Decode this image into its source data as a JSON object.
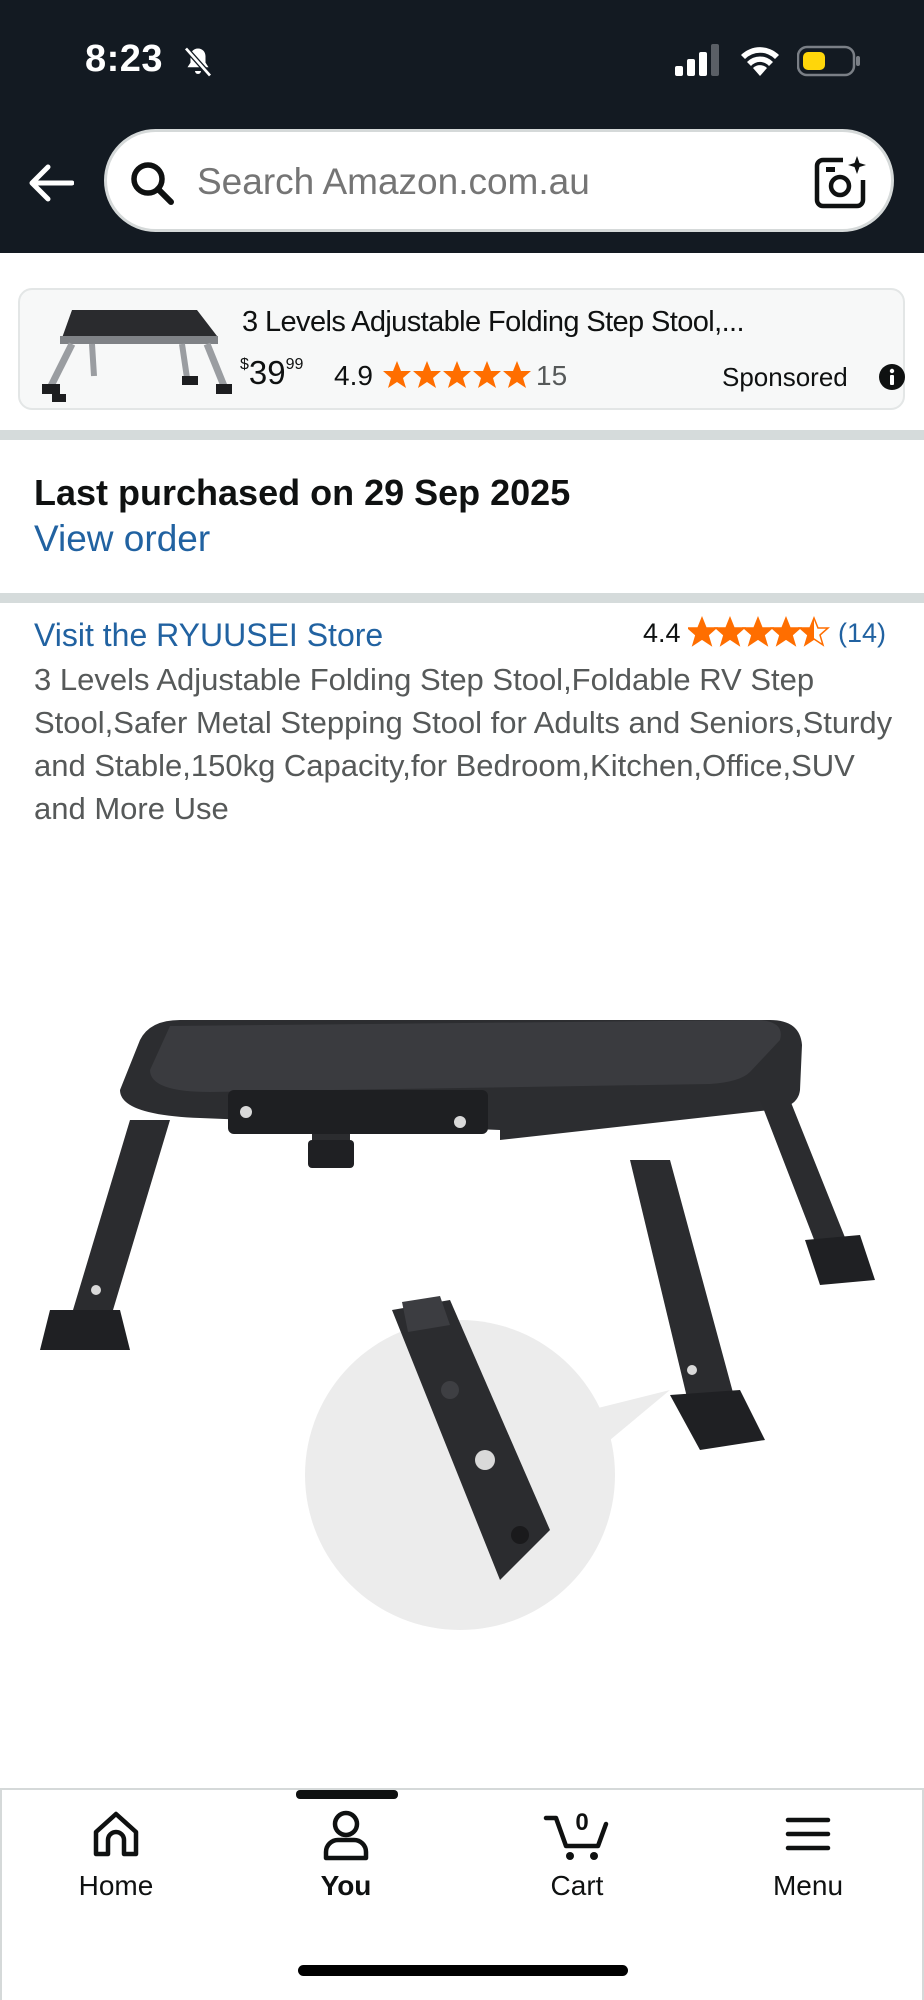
{
  "status_bar": {
    "time": "8:23"
  },
  "header": {
    "search_placeholder": "Search Amazon.com.au"
  },
  "sponsored": {
    "title": "3 Levels Adjustable Folding Step Stool,...",
    "price_symbol": "$",
    "price_whole": "39",
    "price_fraction": "99",
    "rating": "4.9",
    "review_count": "15",
    "label": "Sponsored"
  },
  "purchase": {
    "last_purchased": "Last purchased on 29 Sep 2025",
    "view_order": "View order"
  },
  "product": {
    "store_link": "Visit the RYUUSEI Store",
    "rating": "4.4",
    "rating_value": 4.4,
    "review_count": "(14)",
    "title": "3 Levels Adjustable Folding Step Stool,Foldable RV Step Stool,Safer Metal Stepping Stool for Adults and Seniors,Sturdy and Stable,150kg Capacity,for Bedroom,Kitchen,Office,SUV and More Use"
  },
  "nav": {
    "home": "Home",
    "you": "You",
    "cart": "Cart",
    "cart_count": "0",
    "menu": "Menu"
  },
  "colors": {
    "header_bg": "#131a22",
    "link": "#2162a1",
    "star": "#ff6e00"
  }
}
